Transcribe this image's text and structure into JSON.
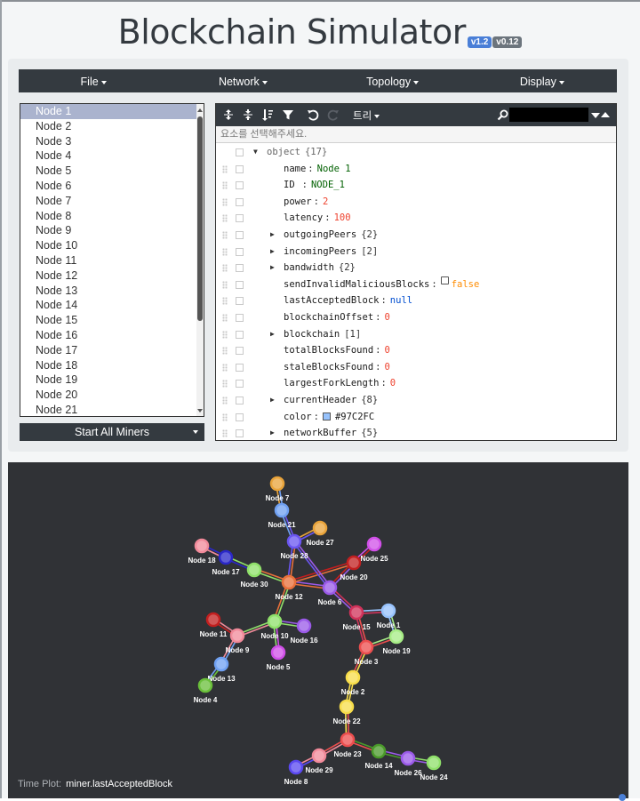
{
  "app": {
    "title": "Blockchain Simulator",
    "version_badges": [
      "v1.2",
      "v0.12"
    ]
  },
  "menubar": {
    "items": [
      "File",
      "Network",
      "Topology",
      "Display"
    ]
  },
  "node_list": {
    "items": [
      "Node 1",
      "Node 2",
      "Node 3",
      "Node 4",
      "Node 5",
      "Node 6",
      "Node 7",
      "Node 8",
      "Node 9",
      "Node 10",
      "Node 11",
      "Node 12",
      "Node 13",
      "Node 14",
      "Node 15",
      "Node 16",
      "Node 17",
      "Node 18",
      "Node 19",
      "Node 20",
      "Node 21"
    ],
    "selected": "Node 1",
    "action_label": "Start All Miners"
  },
  "json_editor": {
    "mode_label": "트리",
    "search_value": "",
    "nav_placeholder": "요소를 선택해주세요.",
    "root": {
      "label": "object",
      "count": "{17}"
    },
    "fields": [
      {
        "key": "name",
        "value": "Node 1",
        "type": "string"
      },
      {
        "key": "ID",
        "value": "NODE_1",
        "type": "string"
      },
      {
        "key": "power",
        "value": "2",
        "type": "number"
      },
      {
        "key": "latency",
        "value": "100",
        "type": "number"
      },
      {
        "key": "outgoingPeers",
        "value": "{2}",
        "type": "object"
      },
      {
        "key": "incomingPeers",
        "value": "[2]",
        "type": "array"
      },
      {
        "key": "bandwidth",
        "value": "{2}",
        "type": "object"
      },
      {
        "key": "sendInvalidMaliciousBlocks",
        "value": "false",
        "type": "boolean"
      },
      {
        "key": "lastAcceptedBlock",
        "value": "null",
        "type": "null"
      },
      {
        "key": "blockchainOffset",
        "value": "0",
        "type": "number"
      },
      {
        "key": "blockchain",
        "value": "[1]",
        "type": "array"
      },
      {
        "key": "totalBlocksFound",
        "value": "0",
        "type": "number"
      },
      {
        "key": "staleBlocksFound",
        "value": "0",
        "type": "number"
      },
      {
        "key": "largestForkLength",
        "value": "0",
        "type": "number"
      },
      {
        "key": "currentHeader",
        "value": "{8}",
        "type": "object"
      },
      {
        "key": "color",
        "value": "#97C2FC",
        "type": "color"
      },
      {
        "key": "networkBuffer",
        "value": "{5}",
        "type": "object"
      }
    ]
  },
  "network": {
    "nodes": [
      {
        "label": "Node 7",
        "color": "#e8a33a"
      },
      {
        "label": "Node 21",
        "color": "#6fa0f2"
      },
      {
        "label": "Node 27",
        "color": "#e8a33a"
      },
      {
        "label": "Node 28",
        "color": "#6a55f0"
      },
      {
        "label": "Node 25",
        "color": "#d04fe8"
      },
      {
        "label": "Node 18",
        "color": "#f18a9a"
      },
      {
        "label": "Node 17",
        "color": "#2a27c8"
      },
      {
        "label": "Node 30",
        "color": "#8fe06a"
      },
      {
        "label": "Node 20",
        "color": "#c21f1f"
      },
      {
        "label": "Node 12",
        "color": "#e8703a"
      },
      {
        "label": "Node 6",
        "color": "#9a5ae8"
      },
      {
        "label": "Node 1",
        "color": "#97C2FC"
      },
      {
        "label": "Node 15",
        "color": "#d0325a"
      },
      {
        "label": "Node 11",
        "color": "#c21f1f"
      },
      {
        "label": "Node 10",
        "color": "#8fe06a"
      },
      {
        "label": "Node 16",
        "color": "#9a5ae8"
      },
      {
        "label": "Node 9",
        "color": "#f18a9a"
      },
      {
        "label": "Node 19",
        "color": "#a6ec85"
      },
      {
        "label": "Node 5",
        "color": "#d04fe8"
      },
      {
        "label": "Node 3",
        "color": "#ec4e4e"
      },
      {
        "label": "Node 13",
        "color": "#6fa0f2"
      },
      {
        "label": "Node 2",
        "color": "#f7dd4a"
      },
      {
        "label": "Node 4",
        "color": "#6abf3a"
      },
      {
        "label": "Node 22",
        "color": "#f7dd4a"
      },
      {
        "label": "Node 23",
        "color": "#ec4e4e"
      },
      {
        "label": "Node 14",
        "color": "#4a9a2a"
      },
      {
        "label": "Node 26",
        "color": "#9a5ae8"
      },
      {
        "label": "Node 24",
        "color": "#8fe06a"
      },
      {
        "label": "Node 29",
        "color": "#f18a9a"
      },
      {
        "label": "Node 8",
        "color": "#5a48f0"
      }
    ],
    "edges": [
      [
        "Node 7",
        "Node 21"
      ],
      [
        "Node 21",
        "Node 28"
      ],
      [
        "Node 28",
        "Node 27"
      ],
      [
        "Node 28",
        "Node 12"
      ],
      [
        "Node 18",
        "Node 17"
      ],
      [
        "Node 17",
        "Node 30"
      ],
      [
        "Node 30",
        "Node 12"
      ],
      [
        "Node 12",
        "Node 6"
      ],
      [
        "Node 12",
        "Node 20"
      ],
      [
        "Node 20",
        "Node 25"
      ],
      [
        "Node 20",
        "Node 6"
      ],
      [
        "Node 6",
        "Node 15"
      ],
      [
        "Node 15",
        "Node 1"
      ],
      [
        "Node 1",
        "Node 19"
      ],
      [
        "Node 15",
        "Node 3"
      ],
      [
        "Node 3",
        "Node 19"
      ],
      [
        "Node 12",
        "Node 10"
      ],
      [
        "Node 10",
        "Node 16"
      ],
      [
        "Node 10",
        "Node 9"
      ],
      [
        "Node 10",
        "Node 5"
      ],
      [
        "Node 11",
        "Node 9"
      ],
      [
        "Node 9",
        "Node 13"
      ],
      [
        "Node 13",
        "Node 4"
      ],
      [
        "Node 3",
        "Node 2"
      ],
      [
        "Node 2",
        "Node 22"
      ],
      [
        "Node 22",
        "Node 23"
      ],
      [
        "Node 23",
        "Node 29"
      ],
      [
        "Node 29",
        "Node 8"
      ],
      [
        "Node 23",
        "Node 14"
      ],
      [
        "Node 14",
        "Node 26"
      ],
      [
        "Node 26",
        "Node 24"
      ],
      [
        "Node 6",
        "Node 28"
      ]
    ],
    "time_plot_label": "Time Plot:",
    "time_plot_value": "miner.lastAcceptedBlock"
  }
}
